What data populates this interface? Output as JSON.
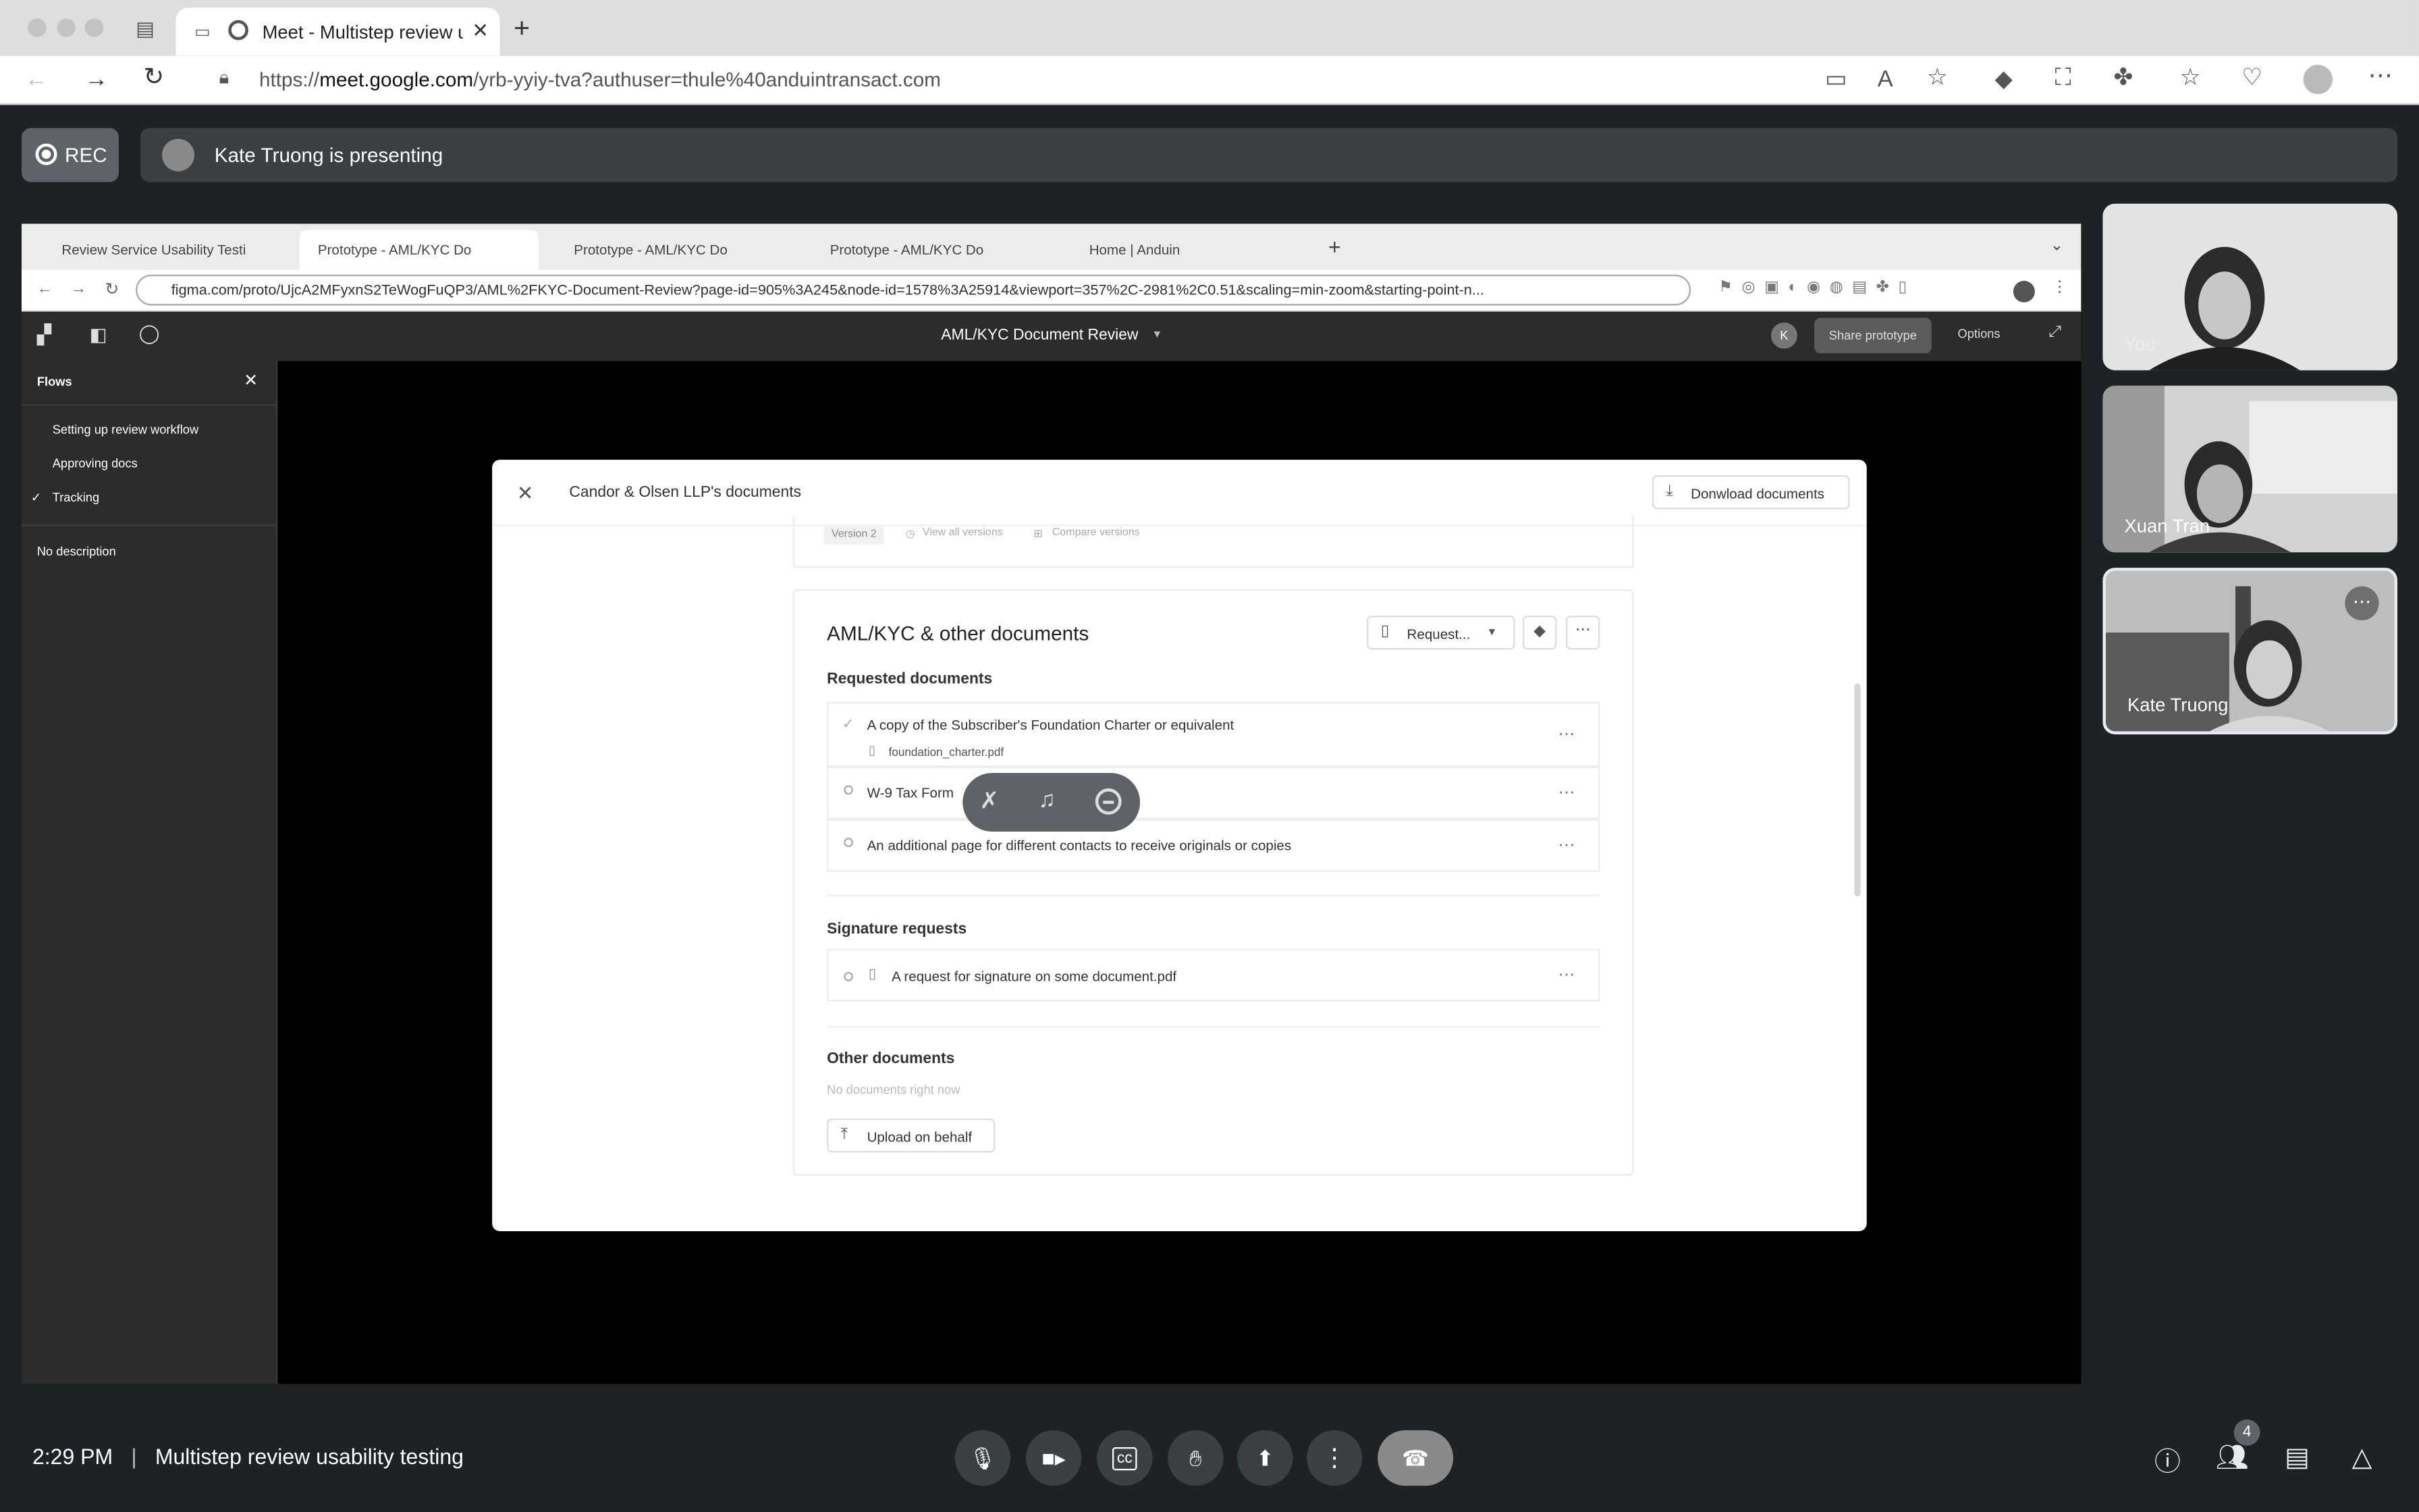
{
  "browser": {
    "tab_title": "Meet - Multistep review u",
    "url_host": "meet.google.com",
    "url_prefix": "https://",
    "url_path": "/yrb-yyiy-tva?authuser=thule%40anduintransact.com"
  },
  "meet": {
    "rec_label": "REC",
    "presenting_text": "Kate Truong is presenting",
    "time": "2:29 PM",
    "meeting_title": "Multistep review usability testing",
    "participants_count": "4",
    "tiles": [
      {
        "name": "You"
      },
      {
        "name": "Xuan Tran"
      },
      {
        "name": "Kate Truong"
      }
    ]
  },
  "shared": {
    "tabs": [
      "Review Service Usability Testi",
      "Prototype - AML/KYC Do",
      "Prototype - AML/KYC Do",
      "Prototype - AML/KYC Do",
      "Home | Anduin"
    ],
    "url": "figma.com/proto/UjcA2MFyxnS2TeWogFuQP3/AML%2FKYC-Document-Review?page-id=905%3A245&node-id=1578%3A25914&viewport=357%2C-2981%2C0.51&scaling=min-zoom&starting-point-n...",
    "figma": {
      "title": "AML/KYC Document Review",
      "avatar": "K",
      "share_label": "Share prototype",
      "options_label": "Options",
      "flows_label": "Flows",
      "flows": [
        "Setting up review workflow",
        "Approving docs",
        "Tracking"
      ],
      "no_description": "No description"
    },
    "modal": {
      "title": "Candor & Olsen LLP's documents",
      "download_label": "Donwload documents",
      "version_label": "Version 2",
      "view_versions": "View all versions",
      "compare_versions": "Compare versions",
      "section_title": "AML/KYC & other documents",
      "request_label": "Request...",
      "requested_heading": "Requested documents",
      "requested": [
        {
          "label": "A copy of the Subscriber's Foundation Charter or equivalent",
          "file": "foundation_charter.pdf"
        },
        {
          "label": "W-9 Tax Form"
        },
        {
          "label": "An additional page for different contacts to receive originals or copies"
        }
      ],
      "signature_heading": "Signature requests",
      "signature_item": "A request for signature on some document.pdf",
      "other_heading": "Other documents",
      "no_documents": "No documents right now",
      "upload_label": "Upload on behalf"
    }
  }
}
